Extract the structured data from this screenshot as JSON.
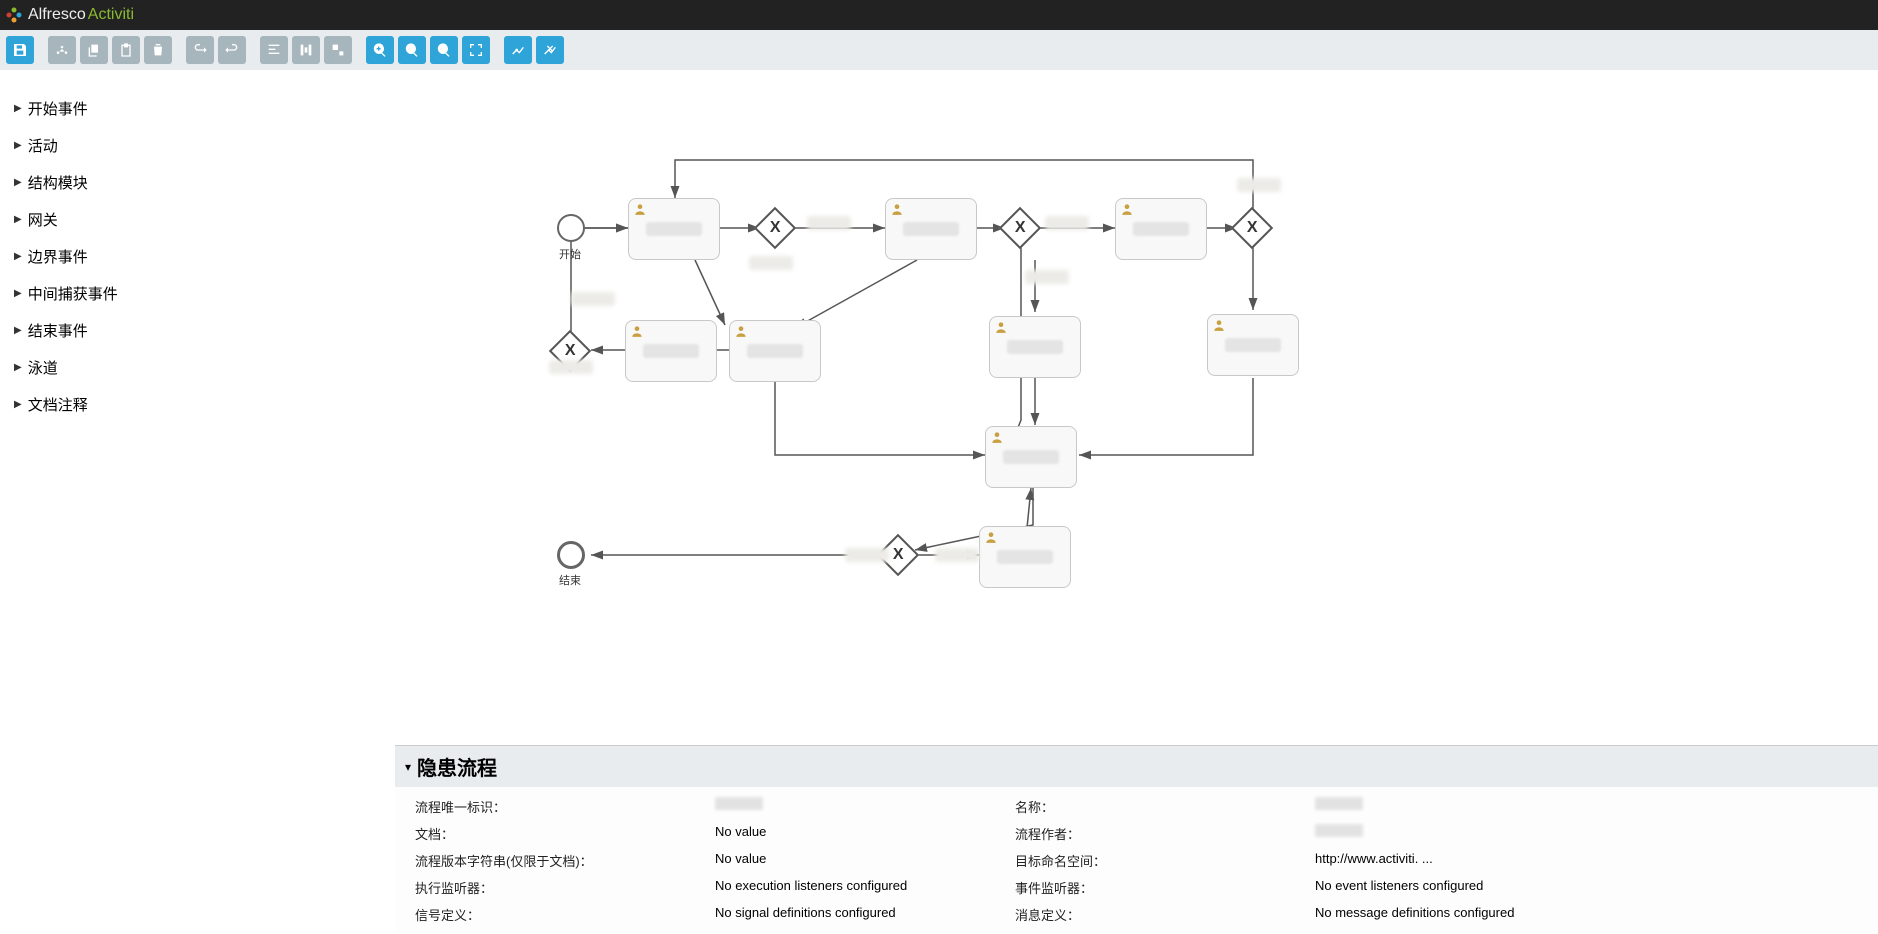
{
  "brand": {
    "alfresco": "Alfresco",
    "activiti": "Activiti"
  },
  "sidebar": {
    "items": [
      {
        "label": "开始事件"
      },
      {
        "label": "活动"
      },
      {
        "label": "结构模块"
      },
      {
        "label": "网关"
      },
      {
        "label": "边界事件"
      },
      {
        "label": "中间捕获事件"
      },
      {
        "label": "结束事件"
      },
      {
        "label": "泳道"
      },
      {
        "label": "文档注释"
      }
    ]
  },
  "diagram": {
    "start_label": "开始",
    "end_label": "结束"
  },
  "props": {
    "title": "隐患流程",
    "rows": [
      {
        "l1": "流程唯一标识：",
        "v1": "",
        "l2": "名称：",
        "v2": ""
      },
      {
        "l1": "文档：",
        "v1": "No value",
        "l2": "流程作者：",
        "v2": ""
      },
      {
        "l1": "流程版本字符串(仅限于文档)：",
        "v1": "No value",
        "l2": "目标命名空间：",
        "v2": "http://www.activiti. ..."
      },
      {
        "l1": "执行监听器：",
        "v1": "No execution listeners configured",
        "l2": "事件监听器：",
        "v2": "No event listeners configured"
      },
      {
        "l1": "信号定义：",
        "v1": "No signal definitions configured",
        "l2": "消息定义：",
        "v2": "No message definitions configured"
      }
    ]
  }
}
